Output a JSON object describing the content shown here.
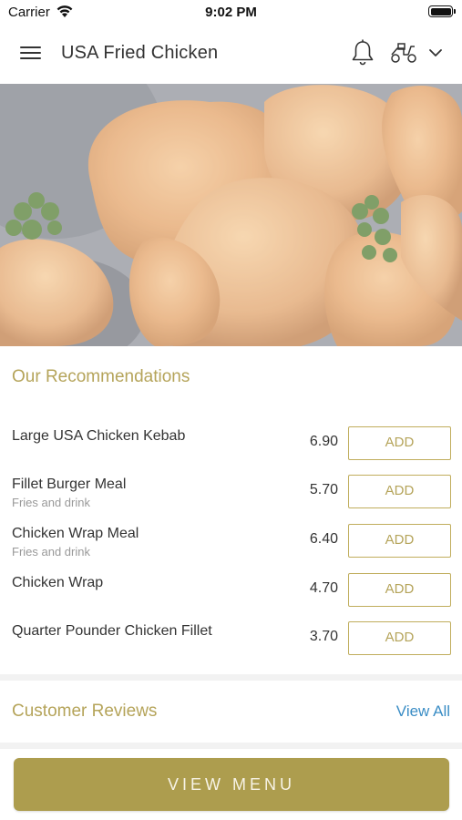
{
  "status_bar": {
    "carrier": "Carrier",
    "time": "9:02 PM"
  },
  "nav": {
    "title": "USA Fried Chicken"
  },
  "recommendations": {
    "title": "Our Recommendations",
    "add_label": "ADD",
    "items": [
      {
        "name": "Large USA Chicken Kebab",
        "subtitle": "",
        "price": "6.90"
      },
      {
        "name": "Fillet Burger Meal",
        "subtitle": "Fries and drink",
        "price": "5.70"
      },
      {
        "name": "Chicken Wrap Meal",
        "subtitle": "Fries and drink",
        "price": "6.40"
      },
      {
        "name": "Chicken Wrap",
        "subtitle": "",
        "price": "4.70"
      },
      {
        "name": "Quarter Pounder Chicken Fillet",
        "subtitle": "",
        "price": "3.70"
      }
    ]
  },
  "reviews": {
    "title": "Customer Reviews",
    "view_all": "View All"
  },
  "footer": {
    "view_menu": "VIEW MENU"
  },
  "colors": {
    "accent": "#b5a45a",
    "button": "#ad9d4e",
    "link": "#3a8dc5"
  },
  "icons": [
    "wifi-icon",
    "battery-icon",
    "hamburger-menu-icon",
    "bell-icon",
    "scooter-icon",
    "chevron-down-icon"
  ]
}
